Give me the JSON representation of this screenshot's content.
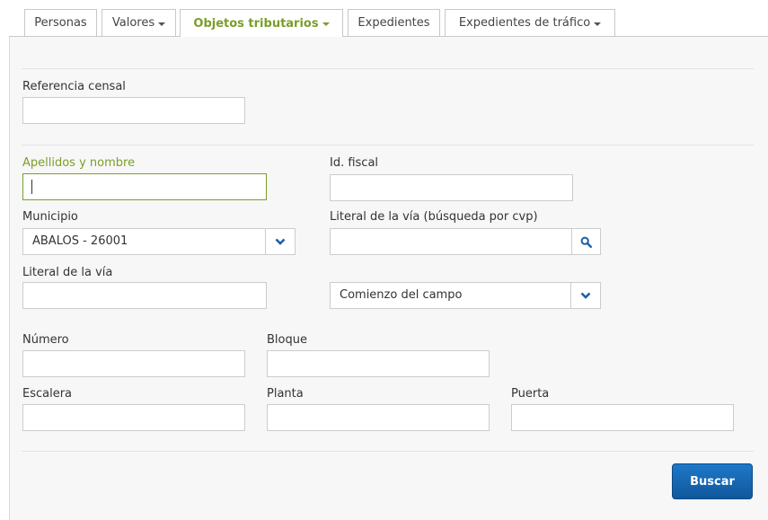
{
  "tabs": [
    {
      "label": "Personas",
      "dropdown": false
    },
    {
      "label": "Valores",
      "dropdown": true
    },
    {
      "label": "Objetos tributarios",
      "dropdown": true,
      "active": true
    },
    {
      "label": "Expedientes",
      "dropdown": false
    },
    {
      "label": "Expedientes de tráfico",
      "dropdown": true
    }
  ],
  "form": {
    "referencia_censal": {
      "label": "Referencia censal",
      "value": ""
    },
    "apellidos_nombre": {
      "label": "Apellidos y nombre",
      "value": ""
    },
    "id_fiscal": {
      "label": "Id. fiscal",
      "value": ""
    },
    "municipio": {
      "label": "Municipio",
      "value": "ABALOS - 26001"
    },
    "literal_via_cvp": {
      "label": "Literal de la vía (búsqueda por cvp)",
      "value": ""
    },
    "literal_via": {
      "label": "Literal de la vía",
      "value": ""
    },
    "modo_busqueda": {
      "value": "Comienzo del campo"
    },
    "numero": {
      "label": "Número",
      "value": ""
    },
    "bloque": {
      "label": "Bloque",
      "value": ""
    },
    "escalera": {
      "label": "Escalera",
      "value": ""
    },
    "planta": {
      "label": "Planta",
      "value": ""
    },
    "puerta": {
      "label": "Puerta",
      "value": ""
    }
  },
  "actions": {
    "search_label": "Buscar"
  },
  "icons": {
    "dropdown": "chevron-down-icon",
    "search": "search-icon"
  },
  "colors": {
    "accent": "#7a9e29",
    "primary": "#1565b0",
    "icon": "#1f5fa8"
  }
}
